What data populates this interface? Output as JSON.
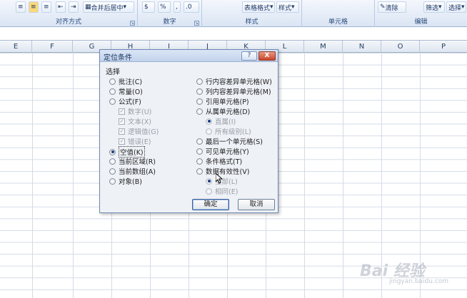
{
  "ribbon": {
    "merge_center": "合并后居中",
    "align_label": "对齐方式",
    "percent": "%",
    "number_label": "数字",
    "table_format": "表格格式",
    "cell_style": "样式",
    "styles_label": "样式",
    "cells_label": "单元格",
    "clear": "清除",
    "filter": "筛选",
    "select": "选择",
    "edit_label": "编辑"
  },
  "columns": [
    "E",
    "F",
    "G",
    "H",
    "I",
    "J",
    "K",
    "L",
    "M",
    "N",
    "O",
    "P"
  ],
  "dialog": {
    "title": "定位条件",
    "help": "?",
    "close": "X",
    "select_label": "选择",
    "left": [
      {
        "label": "批注(C)",
        "state": "radio"
      },
      {
        "label": "常量(O)",
        "state": "radio"
      },
      {
        "label": "公式(F)",
        "state": "radio"
      },
      {
        "label": "数字(U)",
        "state": "check-disabled"
      },
      {
        "label": "文本(X)",
        "state": "check-disabled"
      },
      {
        "label": "逻辑值(G)",
        "state": "check-disabled"
      },
      {
        "label": "错误(E)",
        "state": "check-disabled"
      },
      {
        "label": "空值(K)",
        "state": "radio-selected"
      },
      {
        "label": "当前区域(R)",
        "state": "radio"
      },
      {
        "label": "当前数组(A)",
        "state": "radio"
      },
      {
        "label": "对象(B)",
        "state": "radio"
      }
    ],
    "right": [
      {
        "label": "行内容差异单元格(W)",
        "state": "radio"
      },
      {
        "label": "列内容差异单元格(M)",
        "state": "radio"
      },
      {
        "label": "引用单元格(P)",
        "state": "radio"
      },
      {
        "label": "从属单元格(D)",
        "state": "radio"
      },
      {
        "label": "直属(I)",
        "state": "radio-disabled-selected"
      },
      {
        "label": "所有级别(L)",
        "state": "radio-disabled"
      },
      {
        "label": "最后一个单元格(S)",
        "state": "radio"
      },
      {
        "label": "可见单元格(Y)",
        "state": "radio"
      },
      {
        "label": "条件格式(T)",
        "state": "radio"
      },
      {
        "label": "数据有效性(V)",
        "state": "radio"
      },
      {
        "label": "全部(L)",
        "state": "radio-disabled-selected"
      },
      {
        "label": "相同(E)",
        "state": "radio-disabled"
      }
    ],
    "ok": "确定",
    "cancel": "取消"
  },
  "watermark": {
    "logo": "Bai 经验",
    "url": "jingyan.baidu.com"
  }
}
